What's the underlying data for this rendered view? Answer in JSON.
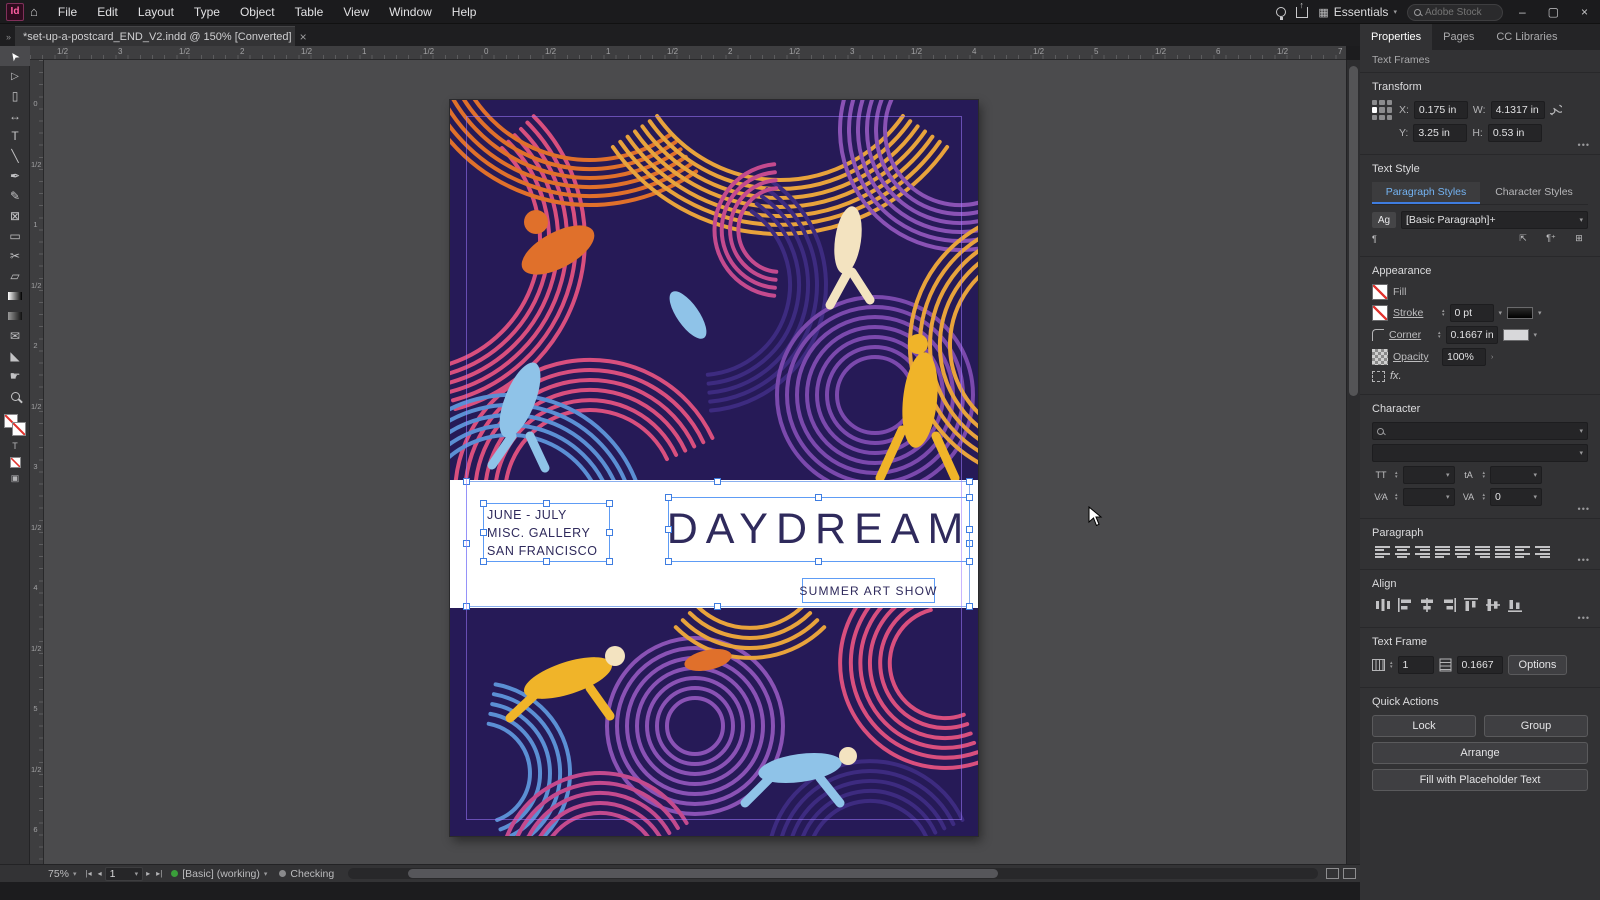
{
  "colors": {
    "accent_blue": "#3f7de0",
    "selection_blue": "#5e9cf5",
    "ink": "#2f2a5c",
    "art_bg": "#261a57",
    "art_pink": "#d94f7e",
    "art_magenta": "#c44a8e",
    "art_orange": "#e0702b",
    "art_amber": "#e8a33c",
    "art_yellow": "#f0b429",
    "art_purple": "#8a52b5",
    "art_violet": "#7b49ad",
    "art_indigo": "#3d2b80",
    "art_blue": "#5b8fd4",
    "art_sky": "#8fc3e8",
    "art_cream": "#f3e3c0",
    "preflight_green": "#3a9e3a",
    "status_gray": "#8a8a8c"
  },
  "menubar": {
    "app_badge": "Id",
    "items": [
      "File",
      "Edit",
      "Layout",
      "Type",
      "Object",
      "Table",
      "View",
      "Window",
      "Help"
    ],
    "workspace_label": "Essentials",
    "workspace_chevron": "▾",
    "search_placeholder": "Adobe Stock",
    "minimize_glyph": "–",
    "maximize_glyph": "▢",
    "close_glyph": "×"
  },
  "tabbar": {
    "collapse_glyph": "»",
    "doc_title": "*set-up-a-postcard_END_V2.indd @ 150% [Converted]",
    "close_glyph": "×"
  },
  "toolbar": {
    "tools": [
      {
        "name": "selection-tool",
        "glyph": "➤"
      },
      {
        "name": "direct-selection-tool",
        "glyph": "▷"
      },
      {
        "name": "page-tool",
        "glyph": "▯"
      },
      {
        "name": "gap-tool",
        "glyph": "↔"
      },
      {
        "name": "type-tool",
        "glyph": "T"
      },
      {
        "name": "line-tool",
        "glyph": "╲"
      },
      {
        "name": "pen-tool",
        "glyph": "✒"
      },
      {
        "name": "pencil-tool",
        "glyph": "✎"
      },
      {
        "name": "rectangle-frame-tool",
        "glyph": "⊠"
      },
      {
        "name": "rectangle-tool",
        "glyph": "▭"
      },
      {
        "name": "scissors-tool",
        "glyph": "✂"
      },
      {
        "name": "free-transform-tool",
        "glyph": "▱"
      },
      {
        "name": "gradient-swatch-tool",
        "glyph": "css:gradient"
      },
      {
        "name": "gradient-feather-tool",
        "glyph": "css:gradient-soft"
      },
      {
        "name": "note-tool",
        "glyph": "✉"
      },
      {
        "name": "eyedropper-tool",
        "glyph": "◣"
      },
      {
        "name": "hand-tool",
        "glyph": "☛"
      },
      {
        "name": "zoom-tool",
        "glyph": "css:magnifier"
      }
    ]
  },
  "rulers": {
    "h_labels": [
      "1/2",
      "3",
      "1/2",
      "2",
      "1/2",
      "1",
      "1/2",
      "0",
      "1/2",
      "1",
      "1/2",
      "2",
      "1/2",
      "3",
      "1/2",
      "4",
      "1/2",
      "5",
      "1/2",
      "6",
      "1/2",
      "7"
    ],
    "v_labels": [
      "0",
      "1/2",
      "1",
      "1/2",
      "2",
      "1/2",
      "3",
      "1/2",
      "4",
      "1/2",
      "5",
      "1/2",
      "6"
    ]
  },
  "artwork": {
    "info_lines": [
      "JUNE - JULY",
      "MISC. GALLERY",
      "SAN FRANCISCO"
    ],
    "title": "DAYDREAM",
    "subtitle": "SUMMER ART SHOW"
  },
  "panel": {
    "tabs": [
      {
        "label": "Properties",
        "active": true
      },
      {
        "label": "Pages",
        "active": false
      },
      {
        "label": "CC Libraries",
        "active": false
      }
    ],
    "selection_type": "Text Frames",
    "transform": {
      "title": "Transform",
      "x_label": "X:",
      "x_value": "0.175 in",
      "y_label": "Y:",
      "y_value": "3.25 in",
      "w_label": "W:",
      "w_value": "4.1317 in",
      "h_label": "H:",
      "h_value": "0.53 in"
    },
    "text_style": {
      "title": "Text Style",
      "paragraph_tab": "Paragraph Styles",
      "character_tab": "Character Styles",
      "style_sample": "Ag",
      "style_name": "[Basic Paragraph]+",
      "para_mark": "¶"
    },
    "appearance": {
      "title": "Appearance",
      "fill_label": "Fill",
      "stroke_label": "Stroke",
      "stroke_value": "0 pt",
      "corner_label": "Corner",
      "corner_value": "0.1667 in",
      "opacity_label": "Opacity",
      "opacity_value": "100%",
      "fx_label": "fx."
    },
    "character": {
      "title": "Character",
      "font_value": "",
      "style_value": "",
      "size_icon": "TT",
      "size_value": "",
      "leading_icon": "tA",
      "leading_value": "",
      "kerning_icon": "V∕A",
      "kerning_value": "",
      "tracking_icon": "VA",
      "tracking_value": "0"
    },
    "paragraph": {
      "title": "Paragraph"
    },
    "align": {
      "title": "Align"
    },
    "text_frame": {
      "title": "Text Frame",
      "columns_value": "1",
      "gutter_value": "0.1667",
      "options_label": "Options"
    },
    "quick_actions": {
      "title": "Quick Actions",
      "pair": [
        "Lock",
        "Group"
      ],
      "full": [
        "Arrange",
        "Fill with Placeholder Text"
      ]
    }
  },
  "statusbar": {
    "zoom": "75%",
    "nav_first": "|◂",
    "nav_prev": "◂",
    "page": "1",
    "nav_next": "▸",
    "nav_last": "▸|",
    "preflight": "[Basic] (working)",
    "status": "Checking"
  }
}
